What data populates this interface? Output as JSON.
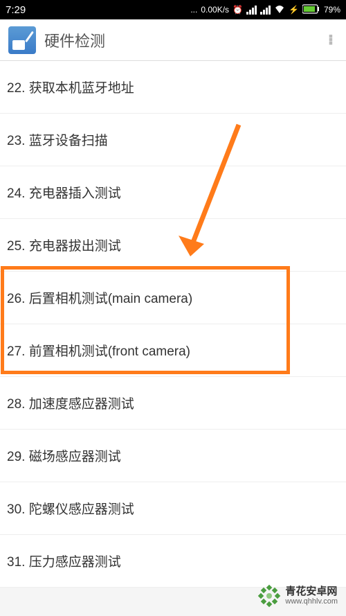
{
  "status_bar": {
    "time": "7:29",
    "net_speed": "0.00K/s",
    "battery_pct": "79%"
  },
  "header": {
    "title": "硬件检测"
  },
  "list": {
    "items": [
      {
        "label": "22. 获取本机蓝牙地址"
      },
      {
        "label": "23. 蓝牙设备扫描"
      },
      {
        "label": "24. 充电器插入测试"
      },
      {
        "label": "25. 充电器拔出测试"
      },
      {
        "label": "26. 后置相机测试(main camera)"
      },
      {
        "label": "27. 前置相机测试(front camera)"
      },
      {
        "label": "28. 加速度感应器测试"
      },
      {
        "label": "29. 磁场感应器测试"
      },
      {
        "label": "30. 陀螺仪感应器测试"
      },
      {
        "label": "31. 压力感应器测试"
      }
    ]
  },
  "annotation": {
    "highlight_color": "#ff7b1a"
  },
  "watermark": {
    "title": "青花安卓网",
    "url": "www.qhhlv.com"
  }
}
